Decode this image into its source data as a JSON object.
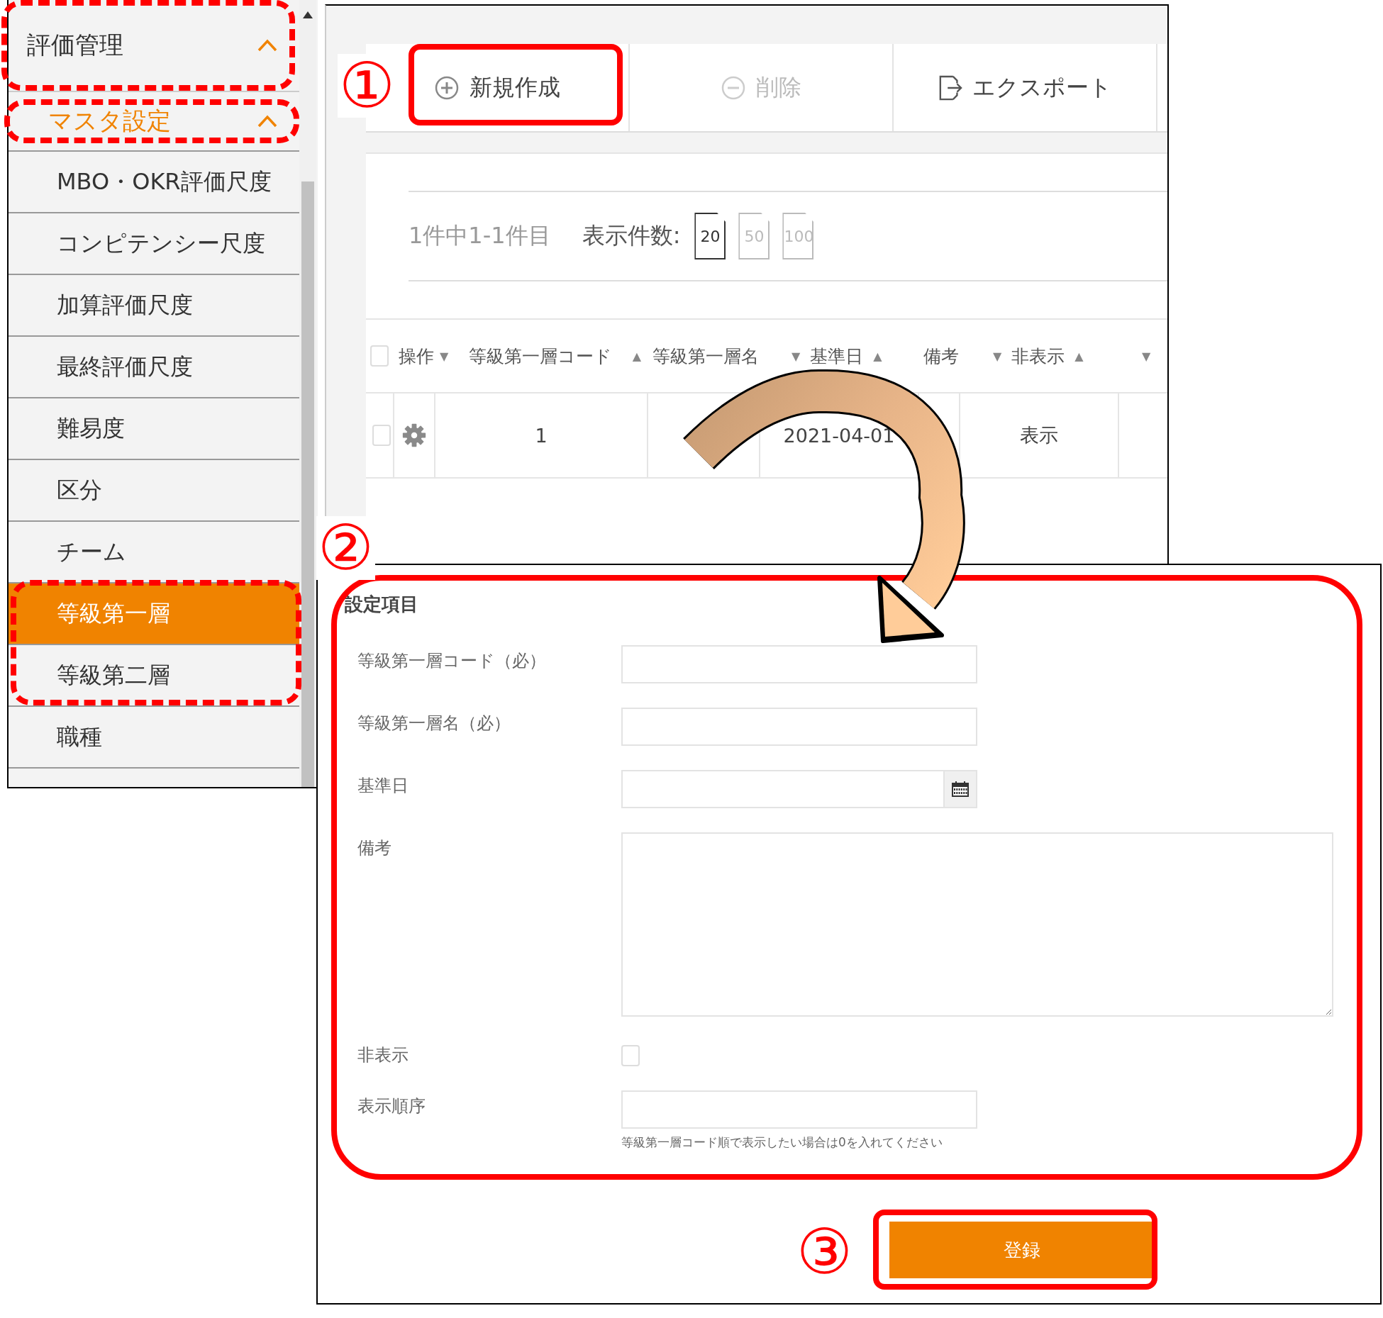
{
  "sidebar": {
    "sections": [
      {
        "label": "評価管理",
        "kind": "group",
        "expanded": true
      },
      {
        "label": "マスタ設定",
        "kind": "subgroup",
        "expanded": true
      }
    ],
    "items": [
      {
        "label": "MBO・OKR評価尺度",
        "selected": false
      },
      {
        "label": "コンピテンシー尺度",
        "selected": false
      },
      {
        "label": "加算評価尺度",
        "selected": false
      },
      {
        "label": "最終評価尺度",
        "selected": false
      },
      {
        "label": "難易度",
        "selected": false
      },
      {
        "label": "区分",
        "selected": false
      },
      {
        "label": "チーム",
        "selected": false
      },
      {
        "label": "等級第一層",
        "selected": true
      },
      {
        "label": "等級第二層",
        "selected": false
      },
      {
        "label": "職種",
        "selected": false
      }
    ]
  },
  "toolbar": [
    {
      "label": "新規作成",
      "kind": "add",
      "disabled": false
    },
    {
      "label": "削除",
      "kind": "delete",
      "disabled": true
    },
    {
      "label": "エクスポート",
      "kind": "export",
      "disabled": false
    }
  ],
  "pagination": {
    "summary": "1件中1-1件目",
    "page_size_label": "表示件数:",
    "page_sizes": [
      {
        "label": "20",
        "selected": true
      },
      {
        "label": "50",
        "selected": false
      },
      {
        "label": "100",
        "selected": false
      }
    ]
  },
  "table": {
    "header_checked": false,
    "columns": [
      {
        "label": "操作"
      },
      {
        "label": "等級第一層コード",
        "sort_before": "▼",
        "sort_after": "▲"
      },
      {
        "label": "等級第一層名"
      },
      {
        "label": "基準日",
        "sort_before": "▼",
        "sort_after": "▲"
      },
      {
        "label": "備考"
      },
      {
        "label": "非表示",
        "sort_before": "▼",
        "sort_after": "▲"
      },
      {
        "sort_before": "▼"
      }
    ],
    "rows": [
      {
        "checked": false,
        "code": "1",
        "date": "2021-04-01",
        "hidden": "表示"
      }
    ]
  },
  "form": {
    "title": "設定項目",
    "fields": [
      {
        "label": "等級第一層コード（必）",
        "kind": "text"
      },
      {
        "label": "等級第一層名（必）",
        "kind": "text"
      },
      {
        "label": "基準日",
        "kind": "date"
      },
      {
        "label": "備考",
        "kind": "textarea"
      },
      {
        "label": "非表示",
        "kind": "checkbox",
        "checked": false
      },
      {
        "label": "表示順序",
        "kind": "text",
        "hint": "等級第一層コード順で表示したい場合は0を入れてください"
      }
    ],
    "submit": "登録"
  },
  "annotations": {
    "markers": [
      "①",
      "②",
      "③"
    ]
  }
}
